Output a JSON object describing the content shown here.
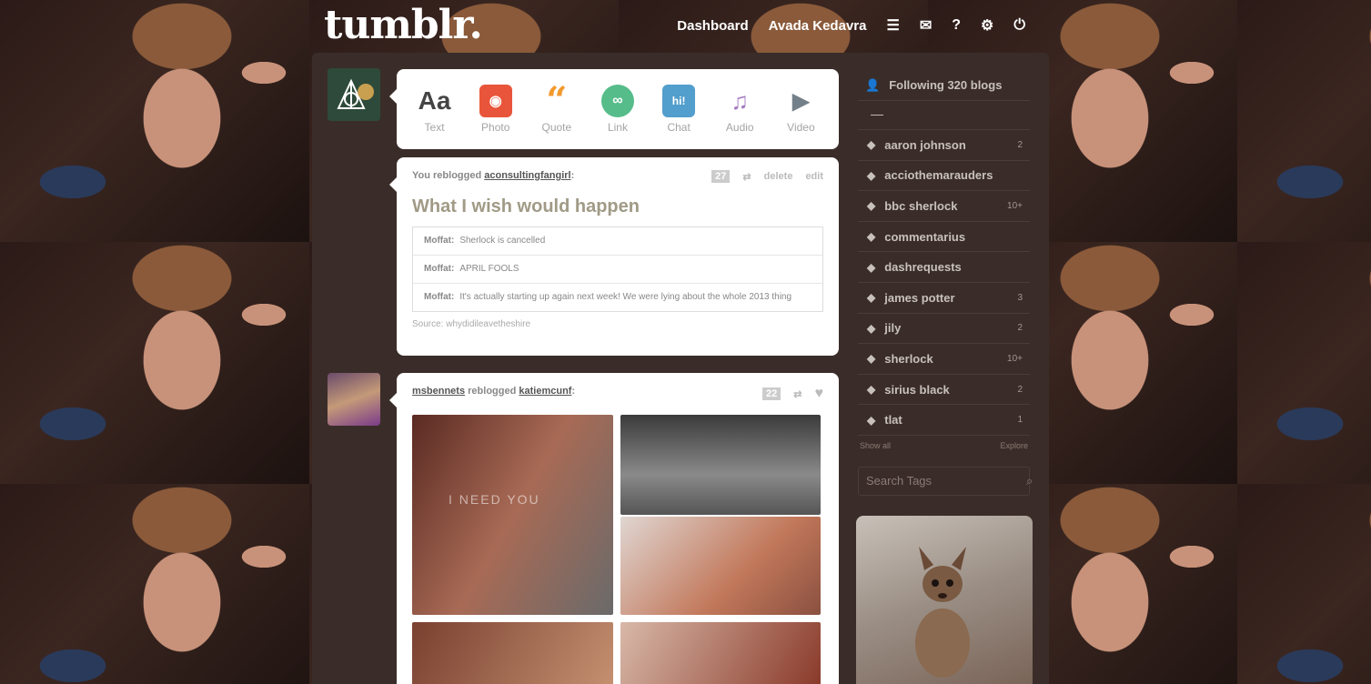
{
  "header": {
    "logo": "tumblr.",
    "nav": {
      "dashboard": "Dashboard",
      "blog_name": "Avada Kedavra"
    }
  },
  "composer": {
    "types": [
      {
        "label": "Text",
        "glyph": "Aa"
      },
      {
        "label": "Photo",
        "glyph": "◉"
      },
      {
        "label": "Quote",
        "glyph": "“"
      },
      {
        "label": "Link",
        "glyph": "∞"
      },
      {
        "label": "Chat",
        "glyph": "hi!"
      },
      {
        "label": "Audio",
        "glyph": "♫"
      },
      {
        "label": "Video",
        "glyph": "▶"
      }
    ]
  },
  "post1": {
    "prefix": "You reblogged",
    "source_blog": "aconsultingfangirl",
    "suffix": ":",
    "notes": "27",
    "delete": "delete",
    "edit": "edit",
    "title": "What I wish would happen",
    "chat": [
      {
        "who": "Moffat:",
        "text": "Sherlock is cancelled"
      },
      {
        "who": "Moffat:",
        "text": "APRIL FOOLS"
      },
      {
        "who": "Moffat:",
        "text": "It's actually starting up again next week! We were lying about the whole 2013 thing"
      }
    ],
    "source_label": "Source:",
    "source_value": "whydidileavetheshire"
  },
  "post2": {
    "blog": "msbennets",
    "reblogged": "reblogged",
    "from": "katiemcunf",
    "suffix": ":",
    "notes": "22",
    "photo_text": "I NEED YOU"
  },
  "sidebar": {
    "following": "Following 320 blogs",
    "dash": "—",
    "tags": [
      {
        "name": "aaron johnson",
        "count": "2"
      },
      {
        "name": "acciothemarauders",
        "count": ""
      },
      {
        "name": "bbc sherlock",
        "count": "10+"
      },
      {
        "name": "commentarius",
        "count": ""
      },
      {
        "name": "dashrequests",
        "count": ""
      },
      {
        "name": "james potter",
        "count": "3"
      },
      {
        "name": "jily",
        "count": "2"
      },
      {
        "name": "sherlock",
        "count": "10+"
      },
      {
        "name": "sirius black",
        "count": "2"
      },
      {
        "name": "tlat",
        "count": "1"
      }
    ],
    "show_all": "Show all",
    "explore": "Explore",
    "search_placeholder": "Search Tags"
  }
}
